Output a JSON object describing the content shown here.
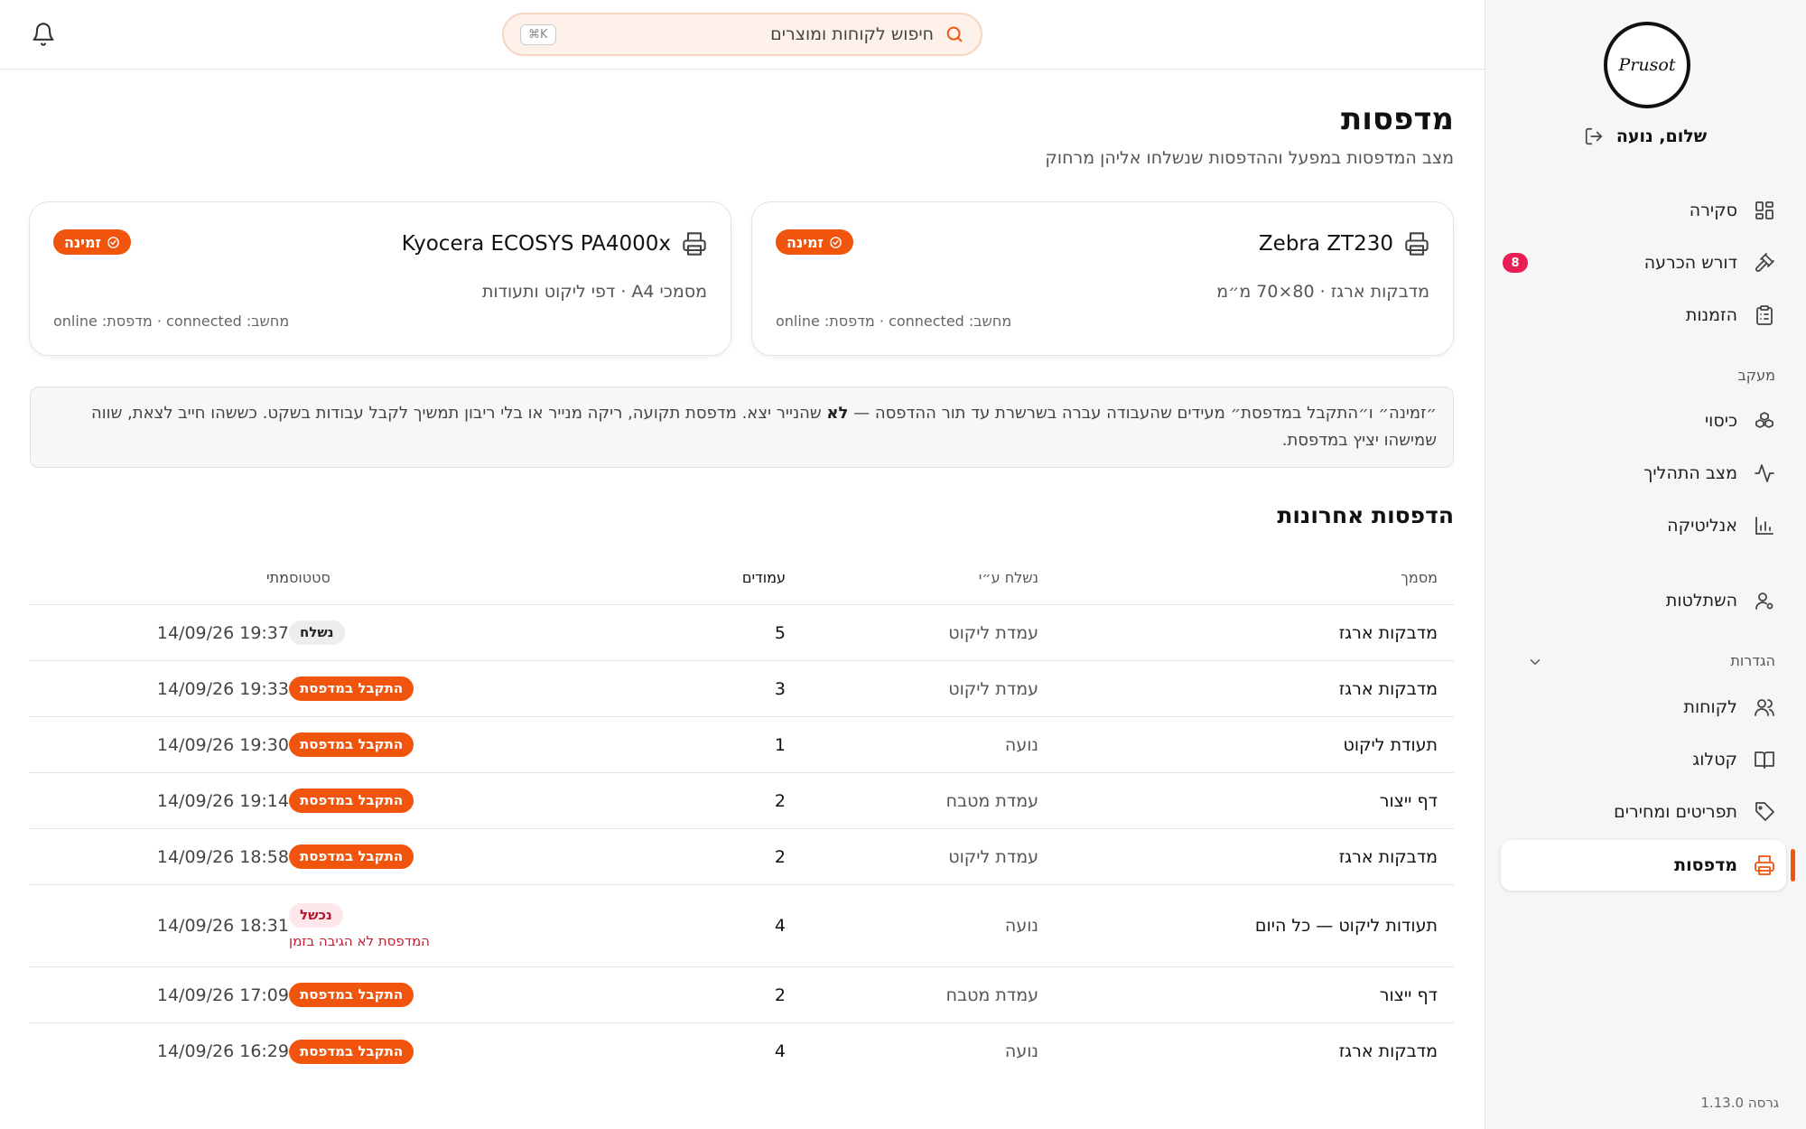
{
  "user": {
    "greeting": "שלום, נועה",
    "logo_text": "Prusot"
  },
  "search": {
    "placeholder": "חיפוש לקוחות ומוצרים",
    "shortcut": "⌘K"
  },
  "nav": {
    "overview": "סקירה",
    "decisions": "דורש הכרעה",
    "decisions_badge": "8",
    "orders": "הזמנות",
    "tracking_section": "מעקב",
    "coverage": "כיסוי",
    "process": "מצב התהליך",
    "analytics": "אנליטיקה",
    "takeover": "השתלטות",
    "settings_section": "הגדרות",
    "customers": "לקוחות",
    "catalog": "קטלוג",
    "menus": "תפריטים ומחירים",
    "printers": "מדפסות"
  },
  "version": "גרסה 1.13.0",
  "page": {
    "title": "מדפסות",
    "subtitle": "מצב המדפסות במפעל וההדפסות שנשלחו אליהן מרחוק"
  },
  "printers": [
    {
      "name": "Zebra ZT230",
      "status": "זמינה",
      "desc": "מדבקות ארגז · 80×70 מ״מ",
      "conn": "מחשב: connected · מדפסת: online"
    },
    {
      "name": "Kyocera ECOSYS PA4000x",
      "status": "זמינה",
      "desc": "מסמכי A4 · דפי ליקוט ותעודות",
      "conn": "מחשב: connected · מדפסת: online"
    }
  ],
  "notice": {
    "part1": "״זמינה״ ו״התקבל במדפסת״ מעידים שהעבודה עברה בשרשרת עד תור ההדפסה — ",
    "bold": "לא",
    "part2": " שהנייר יצא. מדפסת תקועה, ריקה מנייר או בלי ריבון תמשיך לקבל עבודות בשקט. כששהו חייב לצאת, שווה שמישהו יציץ במדפסת."
  },
  "recent": {
    "title": "הדפסות אחרונות",
    "columns": {
      "doc": "מסמך",
      "by": "נשלח ע״י",
      "pages": "עמודים",
      "status": "סטטוס",
      "when": "מתי"
    },
    "rows": [
      {
        "doc": "מדבקות ארגז",
        "by": "עמדת ליקוט",
        "pages": "5",
        "status": "נשלח",
        "kind": "sent",
        "when": "14/09/26 19:37"
      },
      {
        "doc": "מדבקות ארגז",
        "by": "עמדת ליקוט",
        "pages": "3",
        "status": "התקבל במדפסת",
        "kind": "received",
        "when": "14/09/26 19:33"
      },
      {
        "doc": "תעודת ליקוט",
        "by": "נועה",
        "pages": "1",
        "status": "התקבל במדפסת",
        "kind": "received",
        "when": "14/09/26 19:30"
      },
      {
        "doc": "דף ייצור",
        "by": "עמדת מטבח",
        "pages": "2",
        "status": "התקבל במדפסת",
        "kind": "received",
        "when": "14/09/26 19:14"
      },
      {
        "doc": "מדבקות ארגז",
        "by": "עמדת ליקוט",
        "pages": "2",
        "status": "התקבל במדפסת",
        "kind": "received",
        "when": "14/09/26 18:58"
      },
      {
        "doc": "תעודות ליקוט — כל היום",
        "by": "נועה",
        "pages": "4",
        "status": "נכשל",
        "kind": "failed",
        "error": "המדפסת לא הגיבה בזמן",
        "when": "14/09/26 18:31"
      },
      {
        "doc": "דף ייצור",
        "by": "עמדת מטבח",
        "pages": "2",
        "status": "התקבל במדפסת",
        "kind": "received",
        "when": "14/09/26 17:09"
      },
      {
        "doc": "מדבקות ארגז",
        "by": "נועה",
        "pages": "4",
        "status": "התקבל במדפסת",
        "kind": "received",
        "when": "14/09/26 16:29"
      }
    ]
  },
  "colors": {
    "accent": "#f0540d",
    "badge": "#e91e55",
    "failed_bg": "#fde7ea",
    "failed_text": "#b2192f"
  }
}
